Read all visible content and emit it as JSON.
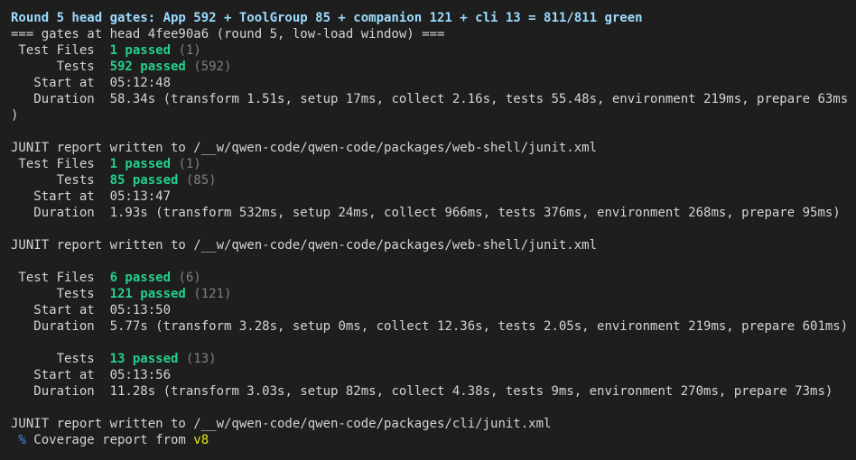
{
  "colors": {
    "background": "#1e1e1e",
    "text": "#d4d4d4",
    "title": "#9cdcfe",
    "passed": "#23d18b",
    "dim": "#808080",
    "percent": "#3b8eea",
    "v8": "#e5e510"
  },
  "header": {
    "title": "Round 5 head gates: App 592 + ToolGroup 85 + companion 121 + cli 13 = 811/811 green",
    "gates_line": "=== gates at head 4fee90a6 (round 5, low-load window) ==="
  },
  "block1": {
    "files_label": " Test Files  ",
    "files_passed": "1 passed",
    "files_total": " (1)",
    "tests_label": "      Tests  ",
    "tests_passed": "592 passed",
    "tests_total": " (592)",
    "start_label": "   Start at  ",
    "start_value": "05:12:48",
    "duration_label": "   Duration  ",
    "duration_value": "58.34s (transform 1.51s, setup 17ms, collect 2.16s, tests 55.48s, environment 219ms, prepare 63ms",
    "duration_wrap": ")"
  },
  "junit1": "JUNIT report written to /__w/qwen-code/qwen-code/packages/web-shell/junit.xml",
  "block2": {
    "files_label": " Test Files  ",
    "files_passed": "1 passed",
    "files_total": " (1)",
    "tests_label": "      Tests  ",
    "tests_passed": "85 passed",
    "tests_total": " (85)",
    "start_label": "   Start at  ",
    "start_value": "05:13:47",
    "duration_label": "   Duration  ",
    "duration_value": "1.93s (transform 532ms, setup 24ms, collect 966ms, tests 376ms, environment 268ms, prepare 95ms)"
  },
  "junit2": "JUNIT report written to /__w/qwen-code/qwen-code/packages/web-shell/junit.xml",
  "block3": {
    "files_label": " Test Files  ",
    "files_passed": "6 passed",
    "files_total": " (6)",
    "tests_label": "      Tests  ",
    "tests_passed": "121 passed",
    "tests_total": " (121)",
    "start_label": "   Start at  ",
    "start_value": "05:13:50",
    "duration_label": "   Duration  ",
    "duration_value": "5.77s (transform 3.28s, setup 0ms, collect 12.36s, tests 2.05s, environment 219ms, prepare 601ms)"
  },
  "block4": {
    "tests_label": "      Tests  ",
    "tests_passed": "13 passed",
    "tests_total": " (13)",
    "start_label": "   Start at  ",
    "start_value": "05:13:56",
    "duration_label": "   Duration  ",
    "duration_value": "11.28s (transform 3.03s, setup 82ms, collect 4.38s, tests 9ms, environment 270ms, prepare 73ms)"
  },
  "junit3": "JUNIT report written to /__w/qwen-code/qwen-code/packages/cli/junit.xml",
  "coverage": {
    "percent_glyph": " %",
    "text": " Coverage report from ",
    "provider": "v8"
  }
}
